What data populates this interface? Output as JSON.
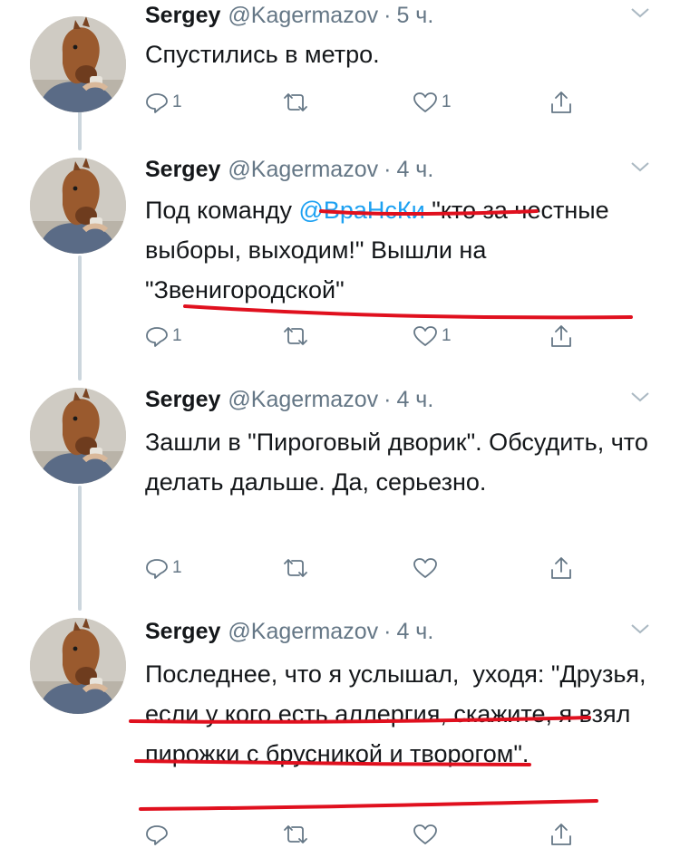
{
  "tweets": [
    {
      "name": "Sergey",
      "handle": "@Kagermazov",
      "time": "5 ч.",
      "text": "Спустились в метро.",
      "replies": "1",
      "retweets": "",
      "likes": "1"
    },
    {
      "name": "Sergey",
      "handle": "@Kagermazov",
      "time": "4 ч.",
      "text_before": "Под команду ",
      "mention": "@ВраНсКи",
      "text_after": " \"кто за честные выборы, выходим!\" Вышли на \"Звенигородской\"",
      "replies": "1",
      "retweets": "",
      "likes": "1"
    },
    {
      "name": "Sergey",
      "handle": "@Kagermazov",
      "time": "4 ч.",
      "text": "Зашли в \"Пироговый дворик\". Обсудить, что делать дальше. Да, серьезно.",
      "replies": "1",
      "retweets": "",
      "likes": ""
    },
    {
      "name": "Sergey",
      "handle": "@Kagermazov",
      "time": "4 ч.",
      "text": "Последнее, что я услышал,  уходя: \"Друзья, если у кого есть аллергия, скажите, я взял пирожки с брусникой и творогом\".",
      "replies": "",
      "retweets": "",
      "likes": ""
    }
  ],
  "icons": {
    "reply": "reply-icon",
    "retweet": "retweet-icon",
    "like": "heart-icon",
    "share": "share-icon",
    "menu": "chevron-down-icon"
  },
  "colors": {
    "mention": "#1da1f2",
    "secondary_text": "#657786",
    "thread_line": "#ccd6dd",
    "annotation": "#e0101e"
  }
}
